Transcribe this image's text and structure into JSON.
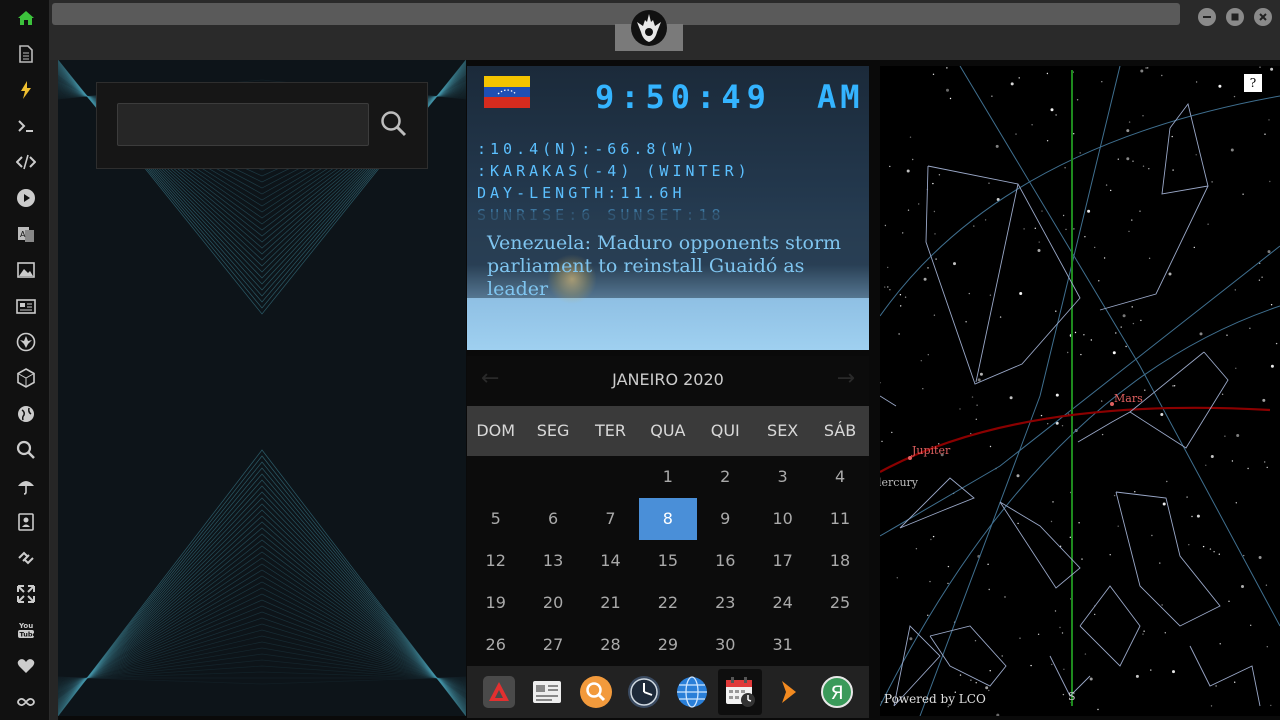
{
  "sidebar": {
    "items": [
      {
        "icon": "home-icon",
        "color": "#3cc23c"
      },
      {
        "icon": "document-icon"
      },
      {
        "icon": "lightning-icon",
        "color": "#f0c030"
      },
      {
        "icon": "terminal-icon"
      },
      {
        "icon": "code-icon"
      },
      {
        "icon": "play-icon"
      },
      {
        "icon": "translate-icon"
      },
      {
        "icon": "image-icon"
      },
      {
        "icon": "newspaper-icon"
      },
      {
        "icon": "rebel-emblem-icon"
      },
      {
        "icon": "hexagon-icon"
      },
      {
        "icon": "globe-icon"
      },
      {
        "icon": "search-icon"
      },
      {
        "icon": "umbrella-icon"
      },
      {
        "icon": "contacts-icon"
      },
      {
        "icon": "link-icon"
      },
      {
        "icon": "expand-icon"
      },
      {
        "icon": "youtube-icon",
        "label": "You Tube"
      },
      {
        "icon": "heart-icon"
      },
      {
        "icon": "infinity-icon"
      }
    ]
  },
  "search": {
    "placeholder": ""
  },
  "clock": {
    "time": "9:50:49",
    "ampm": "AM",
    "coords": ":10.4(N):-66.8(W)",
    "zone": ":KARAKAS(-4) (WINTER)",
    "day_length": "DAY-LENGTH:11.6H",
    "sun_times": "SUNRISE:6 SUNSET:18",
    "news": "Venezuela: Maduro opponents storm parliament to reinstall Guaidó as leader"
  },
  "calendar": {
    "title": "JANEIRO 2020",
    "prev": "←",
    "next": "→",
    "weekdays": [
      "DOM",
      "SEG",
      "TER",
      "QUA",
      "QUI",
      "SEX",
      "SÁB"
    ],
    "weeks": [
      [
        "",
        "",
        "",
        "1",
        "2",
        "3",
        "4"
      ],
      [
        "5",
        "6",
        "7",
        "8",
        "9",
        "10",
        "11"
      ],
      [
        "12",
        "13",
        "14",
        "15",
        "16",
        "17",
        "18"
      ],
      [
        "19",
        "20",
        "21",
        "22",
        "23",
        "24",
        "25"
      ],
      [
        "26",
        "27",
        "28",
        "29",
        "30",
        "31",
        ""
      ]
    ],
    "today": "8",
    "today_color": "#4a8fd8"
  },
  "dock": {
    "items": [
      {
        "icon": "red-triangle-app-icon"
      },
      {
        "icon": "news-reader-icon"
      },
      {
        "icon": "orange-search-icon"
      },
      {
        "icon": "clock-icon"
      },
      {
        "icon": "globe-browser-icon"
      },
      {
        "icon": "calendar-clock-icon",
        "active": true
      },
      {
        "icon": "orange-arrow-icon"
      },
      {
        "icon": "green-ya-icon",
        "label": "Я"
      }
    ]
  },
  "starmap": {
    "help": "?",
    "planets": [
      "Mars",
      "Jupiter",
      "lercury"
    ],
    "horizon_marker": "S",
    "credit": "Powered by LCO"
  },
  "colors": {
    "accent": "#34b4ff",
    "ecliptic": "#8b0000",
    "meridian": "#1e8a1e"
  }
}
